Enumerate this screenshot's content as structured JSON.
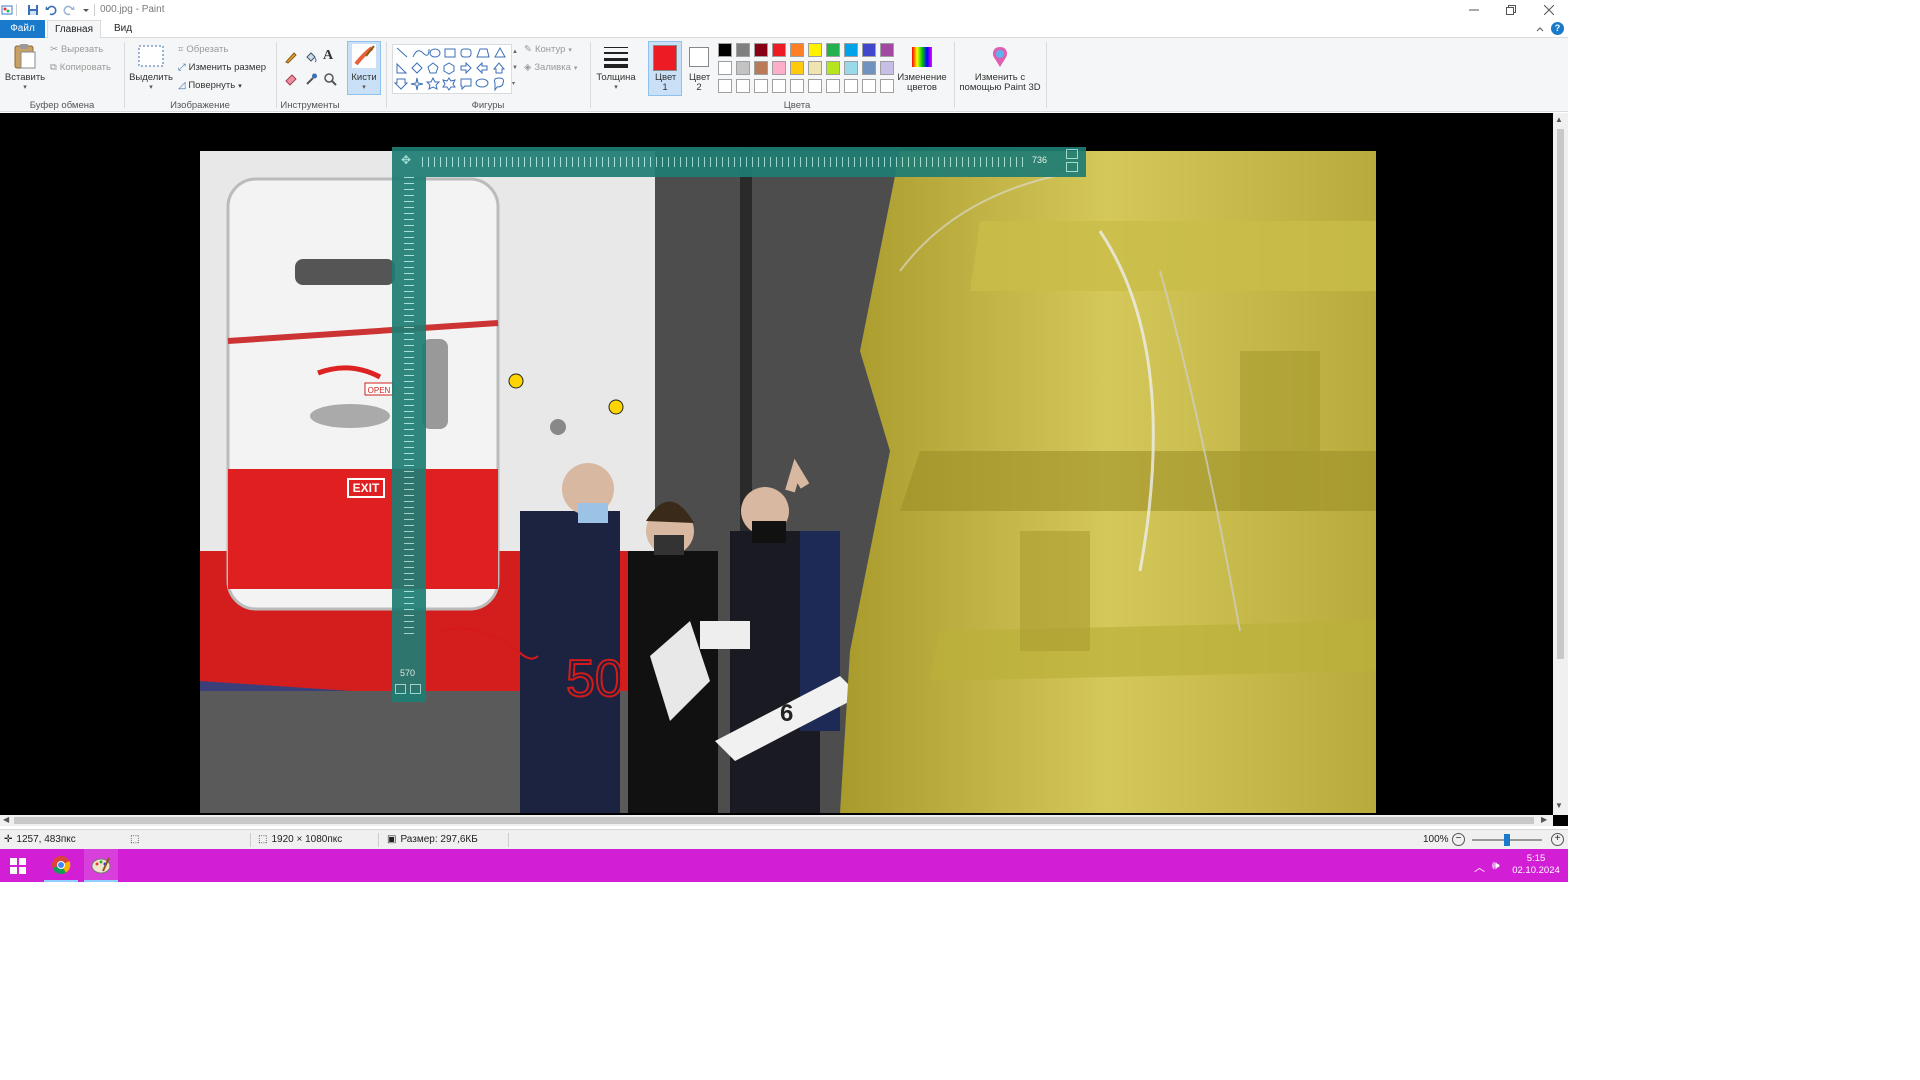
{
  "window": {
    "title": "000.jpg - Paint"
  },
  "menu": {
    "file": "Файл",
    "home": "Главная",
    "view": "Вид"
  },
  "clipboard": {
    "paste": "Вставить",
    "cut": "Вырезать",
    "copy": "Копировать",
    "group": "Буфер обмена"
  },
  "image": {
    "select": "Выделить",
    "crop": "Обрезать",
    "resize": "Изменить размер",
    "rotate": "Повернуть",
    "group": "Изображение"
  },
  "tools": {
    "group": "Инструменты"
  },
  "brushes": {
    "label": "Кисти"
  },
  "shapes": {
    "outline": "Контур",
    "fill": "Заливка",
    "group": "Фигуры"
  },
  "size": {
    "label": "Толщина"
  },
  "colors": {
    "color1_label": "Цвет 1",
    "color2_label": "Цвет 2",
    "color1": "#ed1c24",
    "color2": "#ffffff",
    "edit_colors": "Изменение цветов",
    "group": "Цвета",
    "palette_row1": [
      "#000000",
      "#7f7f7f",
      "#880015",
      "#ed1c24",
      "#ff7f27",
      "#fff200",
      "#22b14c",
      "#00a2e8",
      "#3f48cc",
      "#a349a4"
    ],
    "palette_row2": [
      "#ffffff",
      "#c3c3c3",
      "#b97a57",
      "#ffaec9",
      "#ffc90e",
      "#efe4b0",
      "#b5e61d",
      "#99d9ea",
      "#7092be",
      "#c8bfe7"
    ],
    "palette_row3": [
      "#ffffff",
      "#ffffff",
      "#ffffff",
      "#ffffff",
      "#ffffff",
      "#ffffff",
      "#ffffff",
      "#ffffff",
      "#ffffff",
      "#ffffff"
    ]
  },
  "paint3d": {
    "label": "Изменить с помощью Paint 3D"
  },
  "ruler": {
    "h_value": "736",
    "v_value": "570"
  },
  "photo": {
    "exit_sign": "EXIT",
    "open_sign": "OPEN",
    "panel_number": "6",
    "annotation": "50"
  },
  "status": {
    "cursor": "1257, 483пкс",
    "dimensions": "1920 × 1080пкс",
    "size": "Размер: 297,6КБ",
    "zoom": "100%",
    "zoom_level": 0.5
  },
  "taskbar": {
    "time": "5:15",
    "date": "02.10.2024"
  }
}
